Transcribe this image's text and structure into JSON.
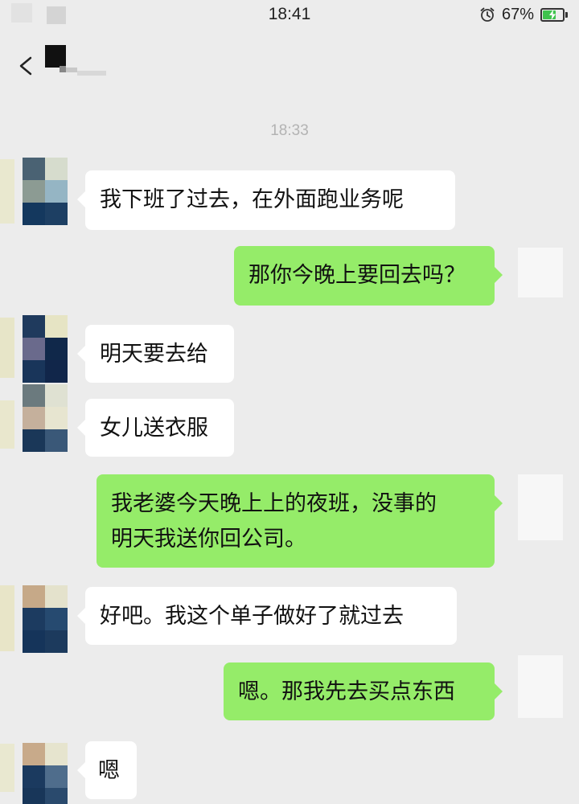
{
  "status_bar": {
    "time": "18:41",
    "battery_percent": "67%",
    "battery_level": 0.67,
    "alarm_icon": "alarm-clock-icon",
    "battery_icon": "battery-charging-icon"
  },
  "header": {
    "back_icon": "chevron-left-icon"
  },
  "chat": {
    "timestamp": "18:33",
    "messages": [
      {
        "side": "in",
        "text": "我下班了过去，在外面跑业务呢"
      },
      {
        "side": "out",
        "text": "那你今晚上要回去吗？"
      },
      {
        "side": "in",
        "text": "明天要去给"
      },
      {
        "side": "in",
        "text": "女儿送衣服"
      },
      {
        "side": "out",
        "text": "我老婆今天晚上上的夜班，没事的\n明天我送你回公司。"
      },
      {
        "side": "in",
        "text": "好吧。我这个单子做好了就过去"
      },
      {
        "side": "out",
        "text": "嗯。那我先去买点东西"
      },
      {
        "side": "in",
        "text": "嗯"
      }
    ]
  },
  "colors": {
    "background": "#ececec",
    "incoming_bubble": "#ffffff",
    "outgoing_bubble": "#95ec69",
    "timestamp_text": "#b3b3b3",
    "battery_fill": "#3ec34d"
  }
}
